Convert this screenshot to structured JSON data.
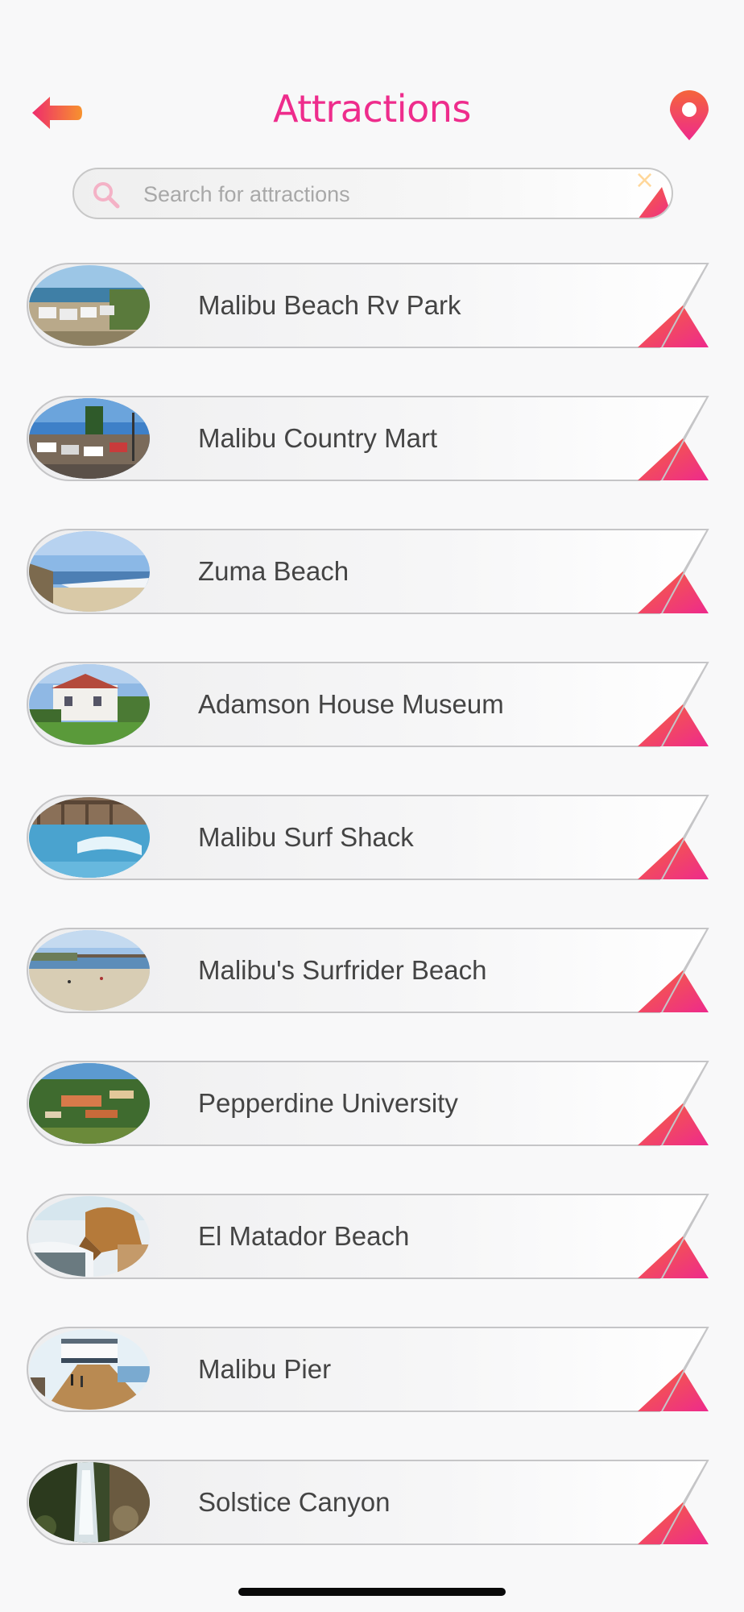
{
  "header": {
    "title": "Attractions",
    "back_icon": "arrow-left-icon",
    "map_icon": "map-pin-icon"
  },
  "search": {
    "placeholder": "Search for attractions",
    "value": "",
    "search_icon": "magnifier-icon",
    "clear_icon": "close-icon"
  },
  "colors": {
    "accent_pink": "#ee2c8c",
    "accent_orange": "#f5653a",
    "text": "#444444",
    "background": "#f8f8f9"
  },
  "attractions": [
    {
      "name": "Malibu Beach Rv Park",
      "thumb": "rv-park"
    },
    {
      "name": "Malibu Country Mart",
      "thumb": "country-mart"
    },
    {
      "name": "Zuma Beach",
      "thumb": "zuma-beach"
    },
    {
      "name": "Adamson House Museum",
      "thumb": "adamson-house"
    },
    {
      "name": "Malibu Surf Shack",
      "thumb": "surf-shack"
    },
    {
      "name": "Malibu's Surfrider Beach",
      "thumb": "surfrider-beach"
    },
    {
      "name": "Pepperdine University",
      "thumb": "pepperdine"
    },
    {
      "name": "El Matador Beach",
      "thumb": "el-matador"
    },
    {
      "name": "Malibu Pier",
      "thumb": "malibu-pier"
    },
    {
      "name": "Solstice Canyon",
      "thumb": "solstice-canyon"
    }
  ]
}
